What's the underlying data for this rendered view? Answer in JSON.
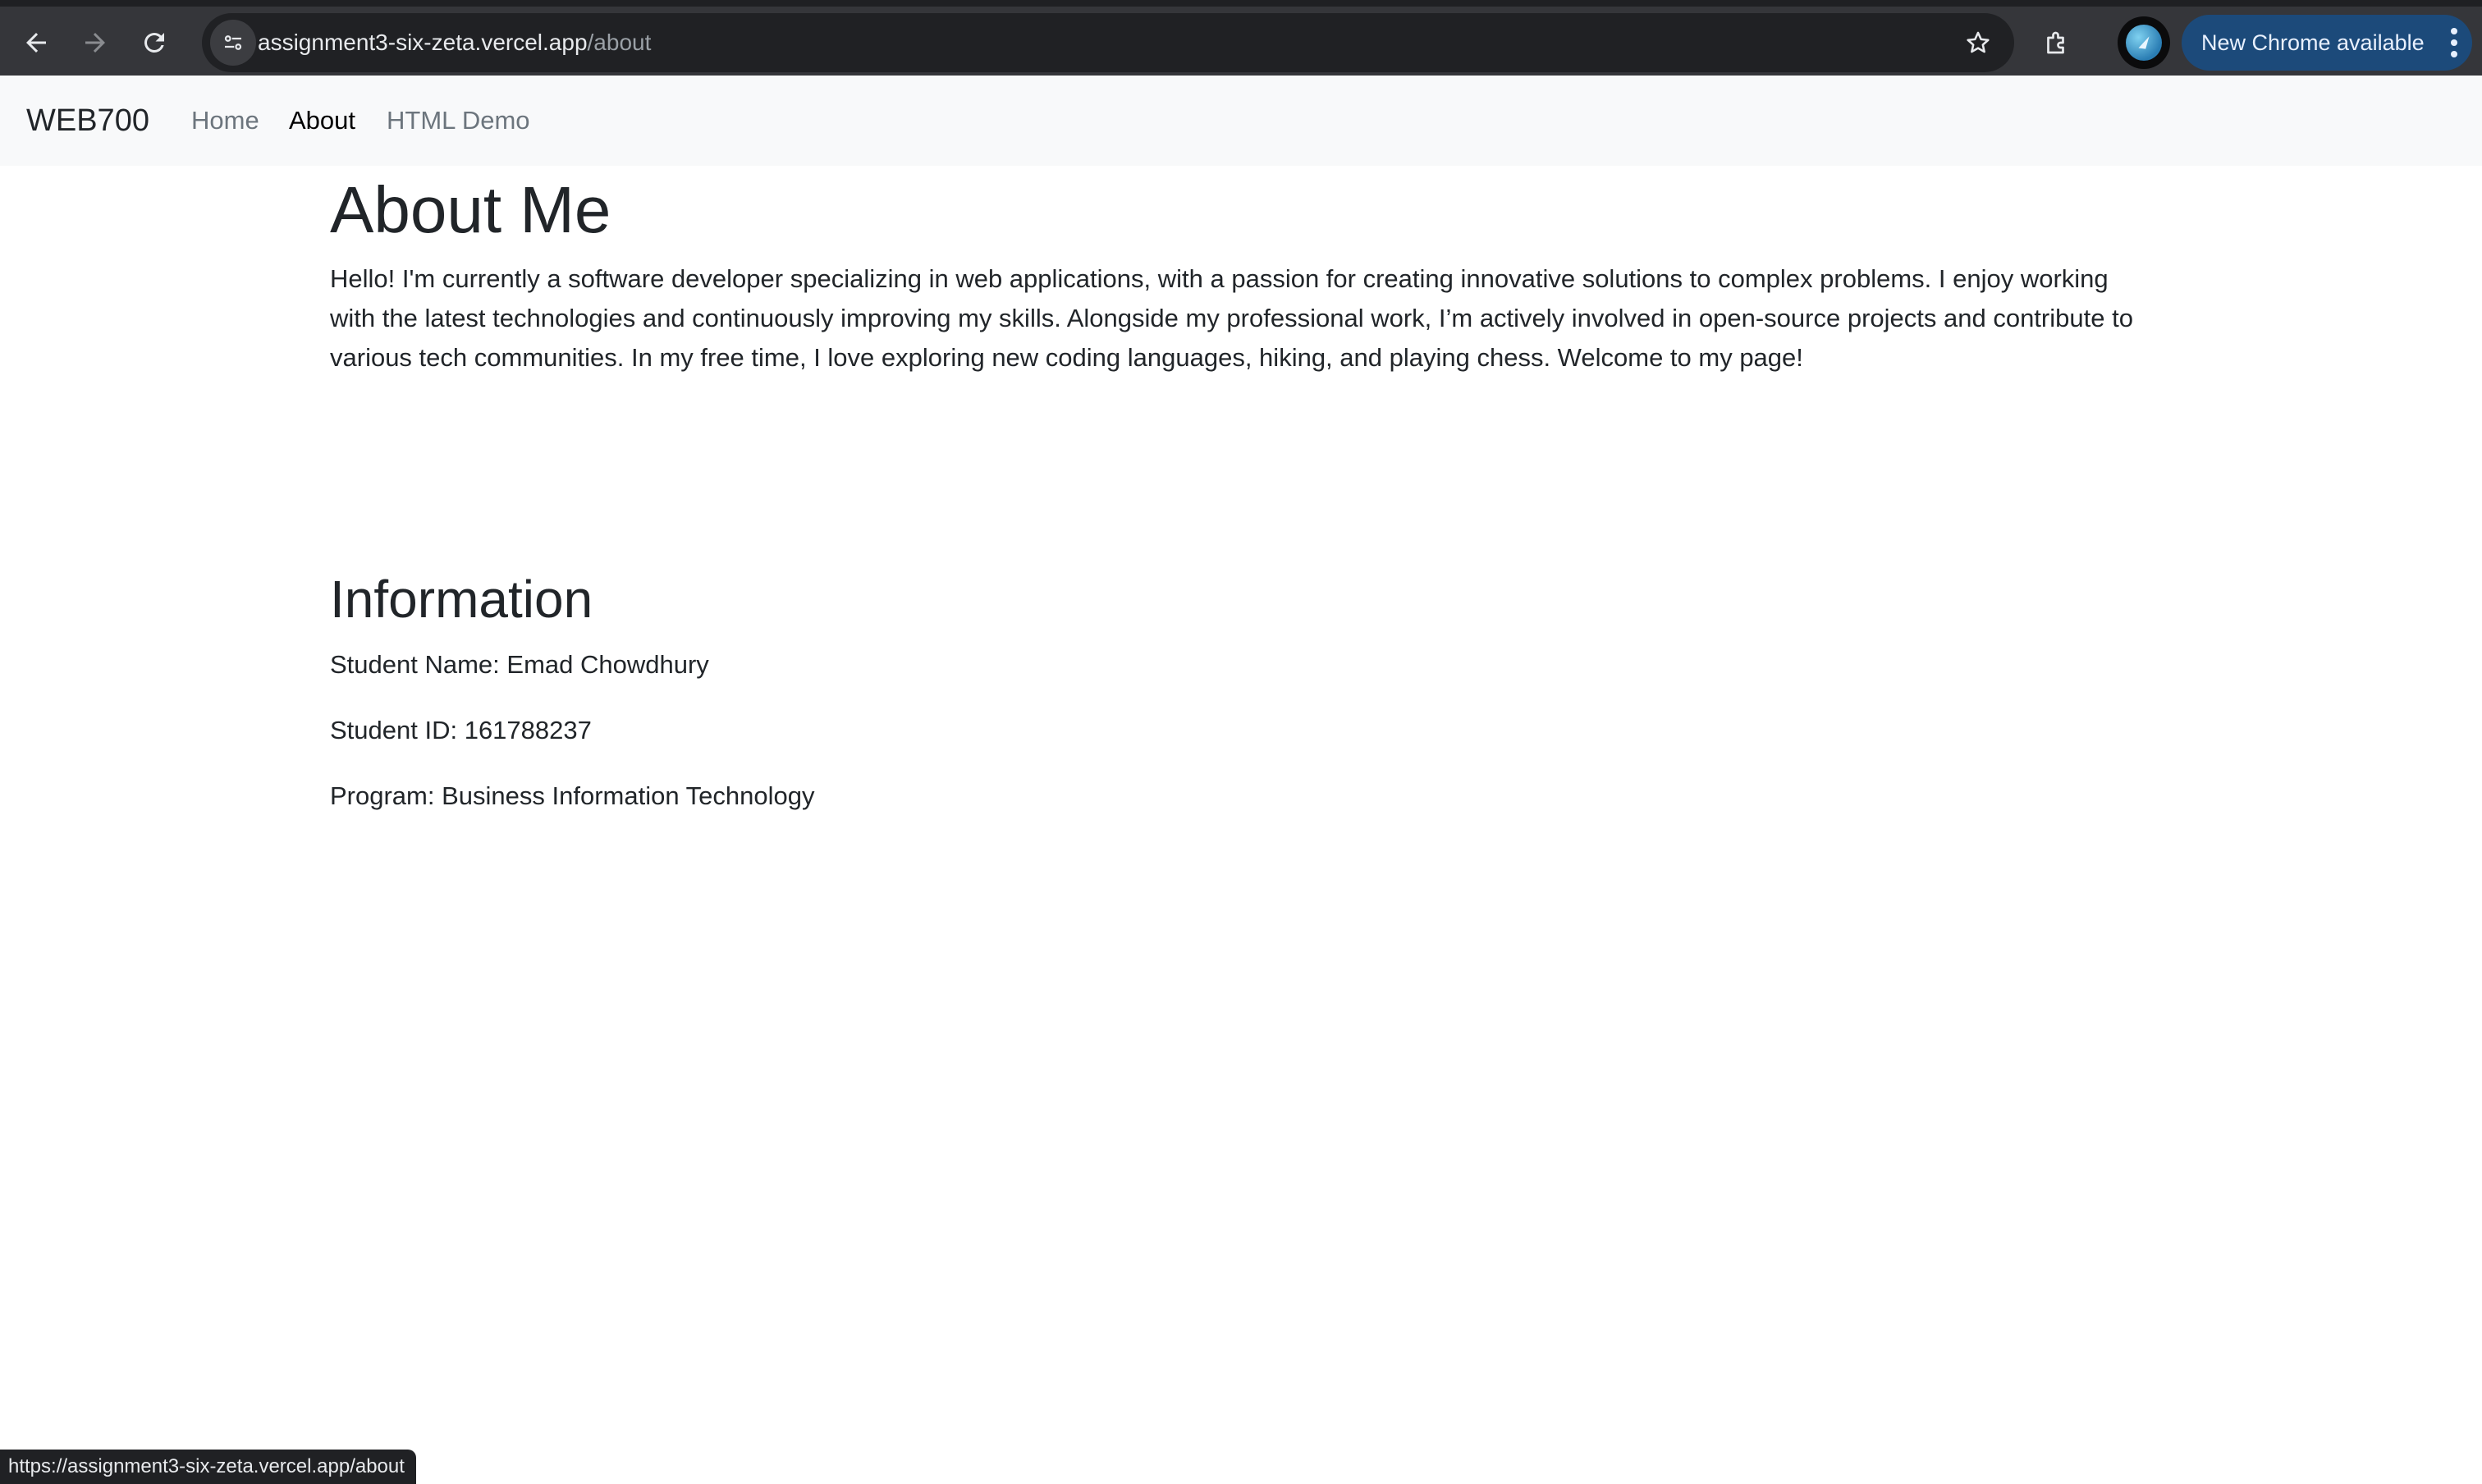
{
  "browser": {
    "url_host": "assignment3-six-zeta.vercel.app",
    "url_path": "/about",
    "update_label": "New Chrome available",
    "status_url": "https://assignment3-six-zeta.vercel.app/about",
    "icons": [
      "back-arrow-icon",
      "forward-arrow-icon",
      "reload-icon",
      "site-info-icon",
      "star-icon",
      "extensions-icon",
      "profile-avatar",
      "kebab-menu-icon"
    ]
  },
  "navbar": {
    "brand": "WEB700",
    "links": [
      {
        "label": "Home",
        "active": false
      },
      {
        "label": "About",
        "active": true
      },
      {
        "label": "HTML Demo",
        "active": false
      }
    ]
  },
  "main": {
    "title": "About Me",
    "intro": "Hello! I'm currently a software developer specializing in web applications, with a passion for creating innovative solutions to complex problems. I enjoy working with the latest technologies and continuously improving my skills. Alongside my professional work, I’m actively involved in open-source projects and contribute to various tech communities. In my free time, I love exploring new coding languages, hiking, and playing chess. Welcome to my page!",
    "info_heading": "Information",
    "info": [
      "Student Name: Emad Chowdhury",
      "Student ID: 161788237",
      "Program: Business Information Technology"
    ]
  },
  "colors": {
    "chrome_bg": "#35363a",
    "omnibox_bg": "#202124",
    "update_button_bg": "#1c4a7a",
    "navbar_bg": "#f8f9fa",
    "text": "#212529",
    "nav_inactive": "#6c757d"
  }
}
